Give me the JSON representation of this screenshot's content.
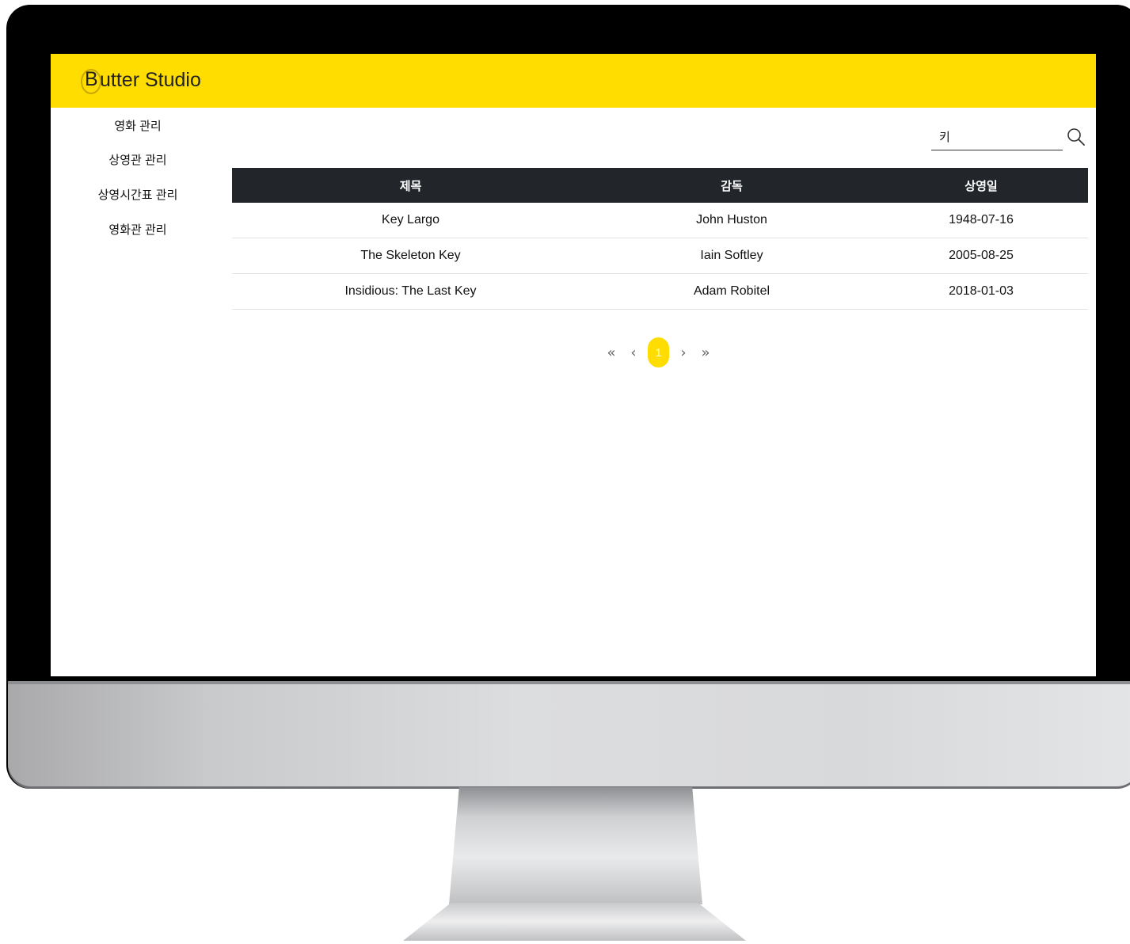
{
  "app": {
    "logo_initial": "B",
    "logo_rest": "utter Studio",
    "brand_color": "#ffdd00"
  },
  "sidebar": {
    "items": [
      {
        "label": "영화 관리"
      },
      {
        "label": "상영관 관리"
      },
      {
        "label": "상영시간표 관리"
      },
      {
        "label": "영화관 관리"
      }
    ]
  },
  "search": {
    "value": "키",
    "icon": "search-icon"
  },
  "table": {
    "headers": [
      "제목",
      "감독",
      "상영일"
    ],
    "rows": [
      {
        "title": "Key Largo",
        "director": "John Huston",
        "date": "1948-07-16"
      },
      {
        "title": "The Skeleton Key",
        "director": "Iain Softley",
        "date": "2005-08-25"
      },
      {
        "title": "Insidious: The Last Key",
        "director": "Adam Robitel",
        "date": "2018-01-03"
      }
    ]
  },
  "pagination": {
    "first": "«",
    "prev": "‹",
    "current_page": "1",
    "next": "›",
    "last": "»"
  }
}
